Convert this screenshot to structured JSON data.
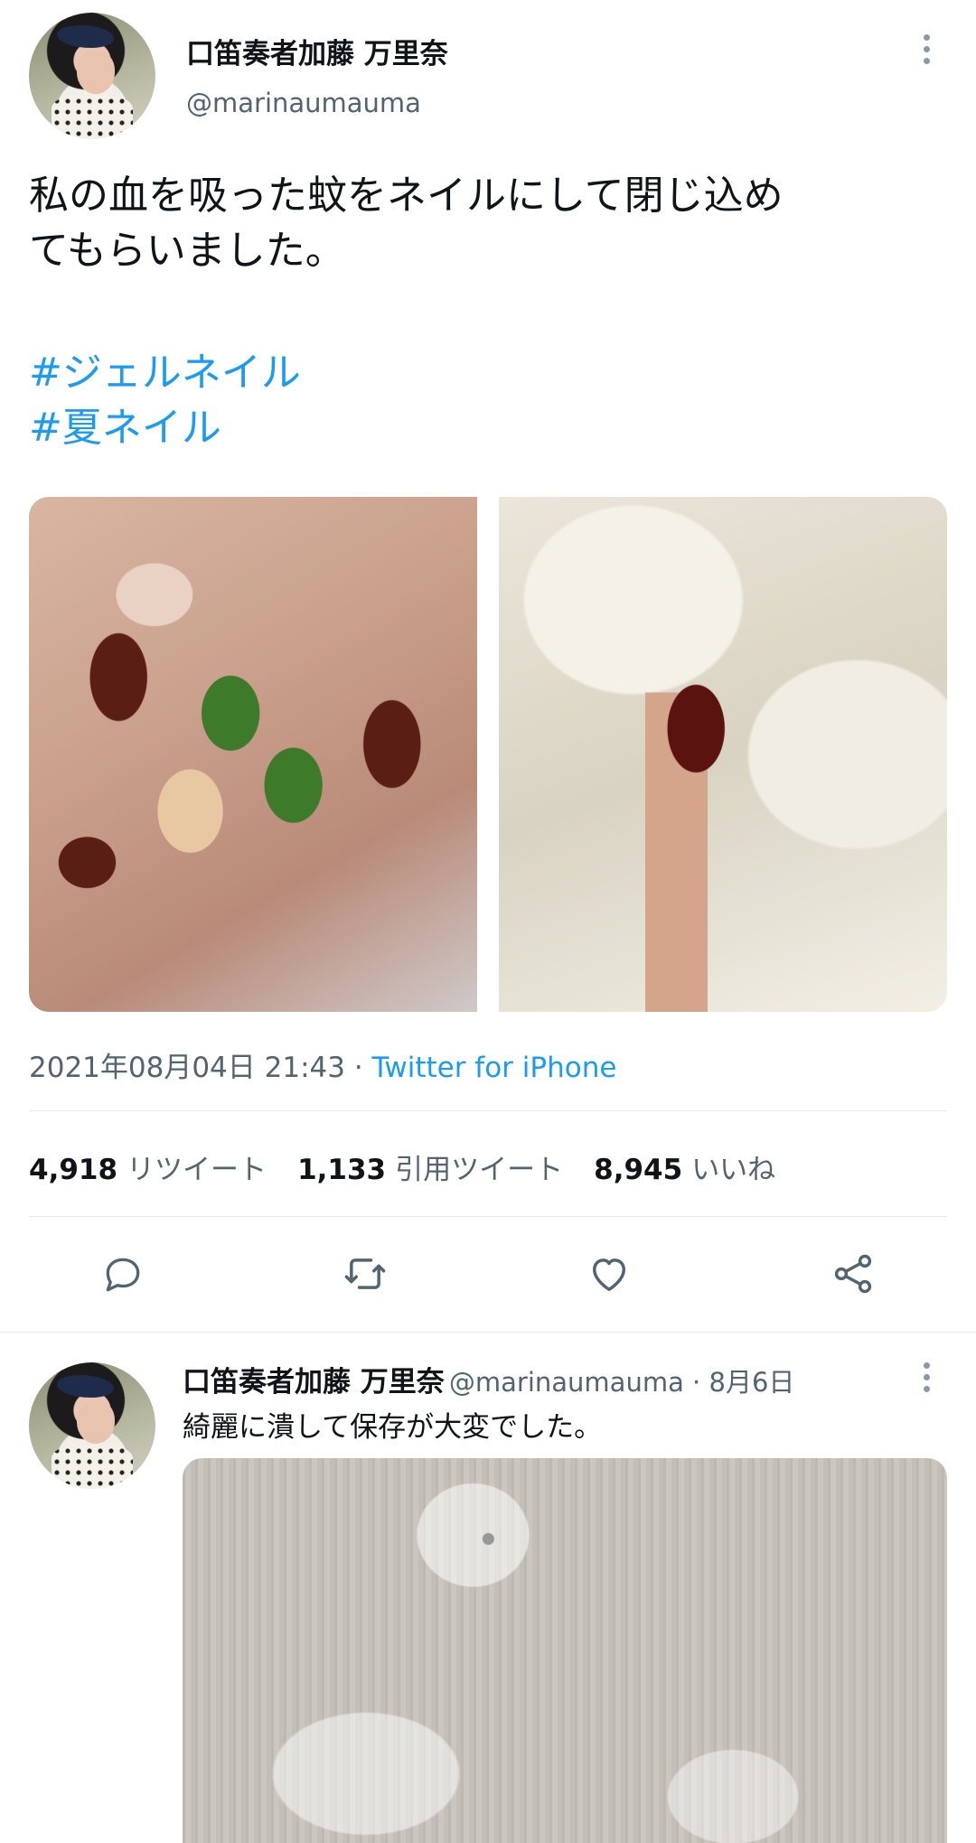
{
  "main_tweet": {
    "author_name": "口笛奏者加藤 万里奈",
    "author_handle": "@marinaumauma",
    "text": "私の血を吸った蚊をネイルにして閉じ込め\nてもらいました。",
    "hashtags": [
      "#ジェルネイル",
      "#夏ネイル"
    ],
    "timestamp": "2021年08月04日 21:43",
    "separator": " · ",
    "source": "Twitter for iPhone",
    "stats": {
      "retweets_count": "4,918",
      "retweets_label": "リツイート",
      "quotes_count": "1,133",
      "quotes_label": "引用ツイート",
      "likes_count": "8,945",
      "likes_label": "いいね"
    },
    "actions": [
      "reply-icon",
      "retweet-icon",
      "like-icon",
      "share-icon"
    ]
  },
  "reply_tweet": {
    "author_name": "口笛奏者加藤 万里奈",
    "author_handle": "@marinaumauma",
    "separator": " · ",
    "date": "8月6日",
    "text": "綺麗に潰して保存が大変でした。"
  },
  "colors": {
    "accent": "#1d9bf0",
    "text_primary": "#0f1419",
    "text_secondary": "#536471",
    "divider": "#e6ecf0"
  }
}
